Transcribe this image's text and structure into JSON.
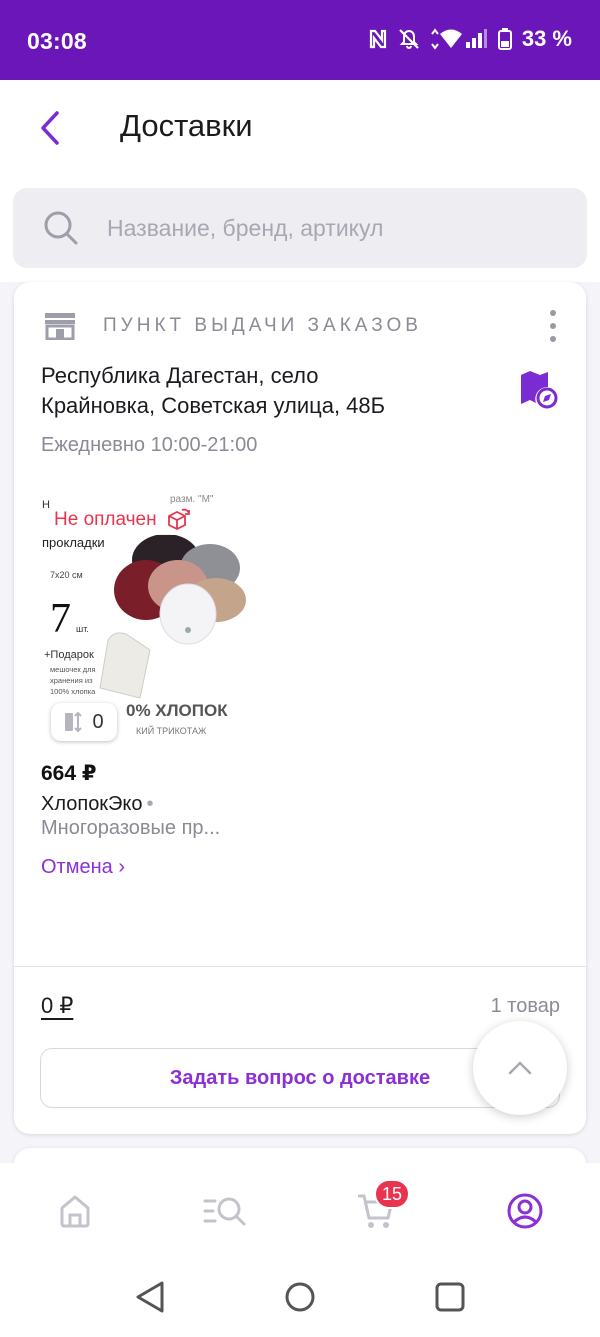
{
  "status_bar": {
    "time": "03:08",
    "battery": "33 %"
  },
  "header": {
    "title": "Доставки"
  },
  "search": {
    "placeholder": "Название, бренд, артикул"
  },
  "delivery": {
    "type_label": "ПУНКТ ВЫДАЧИ ЗАКАЗОВ",
    "address_line1": "Республика Дагестан, село",
    "address_line2": "Крайновка, Советская улица, 48Б",
    "hours": "Ежедневно 10:00-21:00",
    "item": {
      "status": "Не оплачен",
      "compare_count": "0",
      "price": "664 ₽",
      "brand": "ХлопокЭко",
      "brand_separator": "•",
      "name": "Многоразовые пр...",
      "image_text": {
        "heading": "прокладки",
        "size": "7x20 см",
        "count": "7",
        "count_unit": "шт.",
        "gift": "+Подарок",
        "gift_desc_1": "мешочек для",
        "gift_desc_2": "хранения из",
        "gift_desc_3": "100% хлопка",
        "material": "0% ХЛОПОК",
        "fabric": "КИЙ ТРИКОТАЖ",
        "top_left": "Н",
        "top_size": "разм. \"M\""
      },
      "cancel_label": "Отмена ›"
    },
    "total": "0 ₽",
    "count_label": "1 товар",
    "ask_button": "Задать вопрос о доставке"
  },
  "bottom_nav": {
    "cart_badge": "15"
  },
  "colors": {
    "brand": "#6b16b8",
    "accent": "#8b2fd6",
    "alert": "#e8344e"
  },
  "icons": [
    "back-icon",
    "search-icon",
    "store-icon",
    "more-icon",
    "map-icon",
    "package-return-icon",
    "compare-icon",
    "chevron-up-icon",
    "home-icon",
    "catalog-icon",
    "cart-icon",
    "profile-icon"
  ]
}
